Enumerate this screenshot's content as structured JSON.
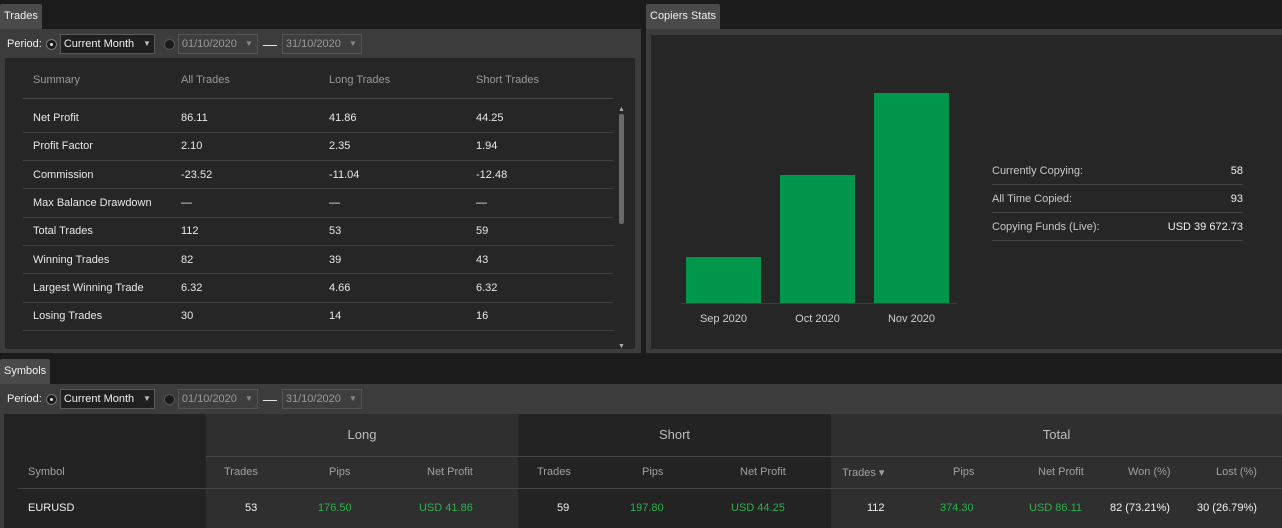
{
  "trades": {
    "tab_label": "Trades",
    "period_label": "Period:",
    "period_value": "Current Month",
    "date_from": "01/10/2020",
    "date_to": "31/10/2020",
    "date_sep": "—",
    "columns": [
      "Summary",
      "All Trades",
      "Long Trades",
      "Short Trades"
    ],
    "rows": [
      [
        "Net Profit",
        "86.11",
        "41.86",
        "44.25"
      ],
      [
        "Profit Factor",
        "2.10",
        "2.35",
        "1.94"
      ],
      [
        "Commission",
        "-23.52",
        "-11.04",
        "-12.48"
      ],
      [
        "Max Balance Drawdown",
        "—",
        "—",
        "—"
      ],
      [
        "Total Trades",
        "112",
        "53",
        "59"
      ],
      [
        "Winning Trades",
        "82",
        "39",
        "43"
      ],
      [
        "Largest Winning Trade",
        "6.32",
        "4.66",
        "6.32"
      ],
      [
        "Losing Trades",
        "30",
        "14",
        "16"
      ]
    ]
  },
  "copiers": {
    "tab_label": "Copiers Stats",
    "stats": [
      {
        "label": "Currently Copying:",
        "value": "58"
      },
      {
        "label": "All Time Copied:",
        "value": "93"
      },
      {
        "label": "Copying Funds (Live):",
        "value": "USD 39 672.73"
      }
    ]
  },
  "chart_data": {
    "type": "bar",
    "categories": [
      "Sep 2020",
      "Oct 2020",
      "Nov 2020"
    ],
    "values": [
      22,
      61,
      100
    ],
    "ylim": [
      0,
      100
    ],
    "grid": false,
    "color": "#00964b"
  },
  "symbols": {
    "tab_label": "Symbols",
    "period_label": "Period:",
    "period_value": "Current Month",
    "date_from": "01/10/2020",
    "date_to": "31/10/2020",
    "date_sep": "—",
    "groups": [
      "Long",
      "Short",
      "Total"
    ],
    "symbol_header": "Symbol",
    "long_headers": [
      "Trades",
      "Pips",
      "Net Profit"
    ],
    "short_headers": [
      "Trades",
      "Pips",
      "Net Profit"
    ],
    "total_headers": [
      "Trades ▾",
      "Pips",
      "Net Profit",
      "Won (%)",
      "Lost (%)"
    ],
    "row": {
      "symbol": "EURUSD",
      "long_trades": "53",
      "long_pips": "176.50",
      "long_profit": "USD 41.86",
      "short_trades": "59",
      "short_pips": "197.80",
      "short_profit": "USD 44.25",
      "total_trades": "112",
      "total_pips": "374.30",
      "total_profit": "USD 86.11",
      "won": "82 (73.21%)",
      "lost": "30 (26.79%)"
    }
  },
  "colors": {
    "accent_green": "#00964b",
    "value_green": "#2bb24c"
  }
}
